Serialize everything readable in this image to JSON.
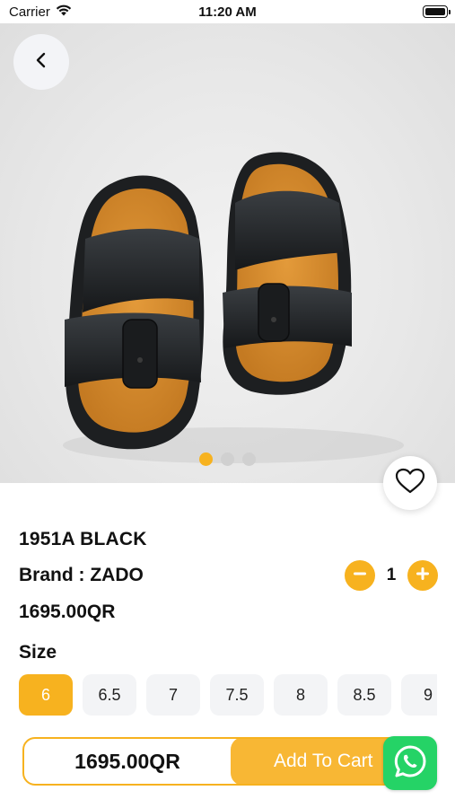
{
  "status_bar": {
    "carrier": "Carrier",
    "time": "11:20 AM"
  },
  "product": {
    "name": "1951A BLACK",
    "brand": "Brand : ZADO",
    "price": "1695.00QR",
    "quantity": "1",
    "image_count": 3,
    "active_image_index": 0
  },
  "size": {
    "label": "Size",
    "options": [
      "6",
      "6.5",
      "7",
      "7.5",
      "8",
      "8.5",
      "9"
    ],
    "selected": "6"
  },
  "cart_bar": {
    "price": "1695.00QR",
    "add_label": "Add To Cart"
  },
  "icons": {
    "back": "chevron-left-icon",
    "favorite": "heart-icon",
    "minus": "minus-icon",
    "plus": "plus-icon",
    "whatsapp": "whatsapp-icon"
  },
  "colors": {
    "accent": "#f7b21f",
    "whatsapp": "#25d366",
    "chip_bg": "#f3f4f6"
  }
}
